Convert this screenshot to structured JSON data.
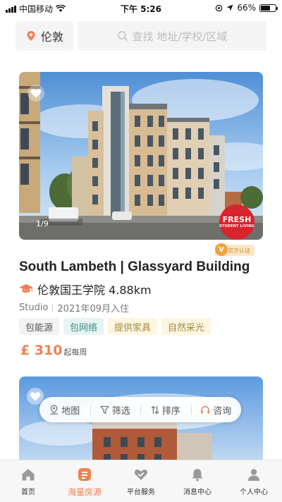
{
  "status_bar": {
    "carrier": "中国移动",
    "time": "下午 5:26",
    "battery": "66%",
    "battery_level": 0.66
  },
  "header": {
    "city": "伦敦",
    "search_placeholder": "查找 地址/学校/区域",
    "icons": [
      "location-pin-icon",
      "search-icon"
    ]
  },
  "listing": {
    "image_counter": "1/9",
    "badge_brand": "FRESH",
    "badge_sub": "STUDENT LIVING",
    "official_badge": "官方认证",
    "official_mark": "V",
    "title": "South Lambeth | Glassyard Building",
    "school": "伦敦国王学院 4.88km",
    "room_type": "Studio",
    "move_in": "2021年09月入住",
    "tags": [
      {
        "label": "包能源",
        "bg": "#f3f3f3",
        "color": "#555555"
      },
      {
        "label": "包网络",
        "bg": "#e7f4f2",
        "color": "#3d8c85"
      },
      {
        "label": "提供家具",
        "bg": "#fdf6e0",
        "color": "#a2883e"
      },
      {
        "label": "自然采光",
        "bg": "#fdf6e0",
        "color": "#a2883e"
      }
    ],
    "price": "£ 310",
    "price_unit": "起每周"
  },
  "filter_bar": {
    "items": [
      {
        "label": "地图",
        "icon": "map-icon"
      },
      {
        "label": "筛选",
        "icon": "filter-icon"
      },
      {
        "label": "排序",
        "icon": "sort-icon"
      },
      {
        "label": "咨询",
        "icon": "headset-icon"
      }
    ]
  },
  "tabbar": {
    "items": [
      {
        "label": "首页",
        "icon": "home-icon"
      },
      {
        "label": "海量房源",
        "icon": "listings-icon"
      },
      {
        "label": "平台服务",
        "icon": "service-icon"
      },
      {
        "label": "消息中心",
        "icon": "bell-icon"
      },
      {
        "label": "个人中心",
        "icon": "user-icon"
      }
    ],
    "active_index": 1
  },
  "colors": {
    "accent": "#f08052",
    "official_gold": "#f0a33c",
    "brand_red": "#d8242c"
  }
}
